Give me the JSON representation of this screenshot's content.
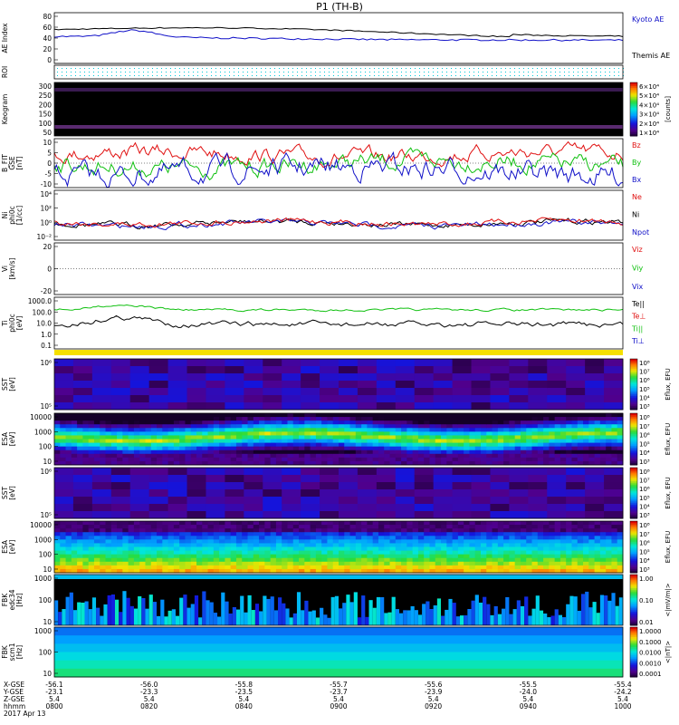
{
  "title": "P1 (TH-B)",
  "colors": {
    "black": "#000000",
    "blue": "#1010c8",
    "red": "#e01010",
    "green": "#10c010",
    "magenta": "#c000c0",
    "cyan": "#00c8d8"
  },
  "panels": [
    {
      "id": "ae",
      "ylabel": "AE Index",
      "ticks": [
        "80",
        "60",
        "40",
        "20",
        "0"
      ],
      "legend": [
        "Kyoto AE",
        "Themis AE"
      ]
    },
    {
      "id": "roi",
      "ylabel": "ROI",
      "ticks": []
    },
    {
      "id": "kp",
      "ylabel": "Keogram",
      "ticks": [
        "300",
        "250",
        "200",
        "150",
        "100",
        "50"
      ],
      "cbar": {
        "ticks": [
          "6×10⁴",
          "5×10⁴",
          "4×10⁴",
          "3×10⁴",
          "2×10⁴",
          "1×10⁴"
        ],
        "label": "[counts]"
      }
    },
    {
      "id": "bfit",
      "ylabel": "B_FIT\nGSE\n[nT]",
      "ticks": [
        "10",
        "5",
        "0",
        "-5",
        "-10"
      ],
      "legend": [
        "Bz",
        "By",
        "Bx"
      ]
    },
    {
      "id": "ni",
      "ylabel": "Ni\nphi0c\n[1/cc]",
      "ticks": [
        "10⁴",
        "10²",
        "10⁰",
        "10⁻²"
      ],
      "legend": [
        "Ne",
        "Ni",
        "Npot"
      ]
    },
    {
      "id": "vi",
      "ylabel": "Vi\n[km/s]",
      "ticks": [
        "20",
        "0",
        "-20"
      ],
      "legend": [
        "Viz",
        "Viy",
        "Vix"
      ]
    },
    {
      "id": "ti",
      "ylabel": "Ti\nphi0c\n[eV]",
      "ticks": [
        "1000.0",
        "100.0",
        "10.0",
        "1.0",
        "0.1"
      ],
      "legend": [
        "Te||",
        "Te⊥",
        "Ti||",
        "Ti⊥"
      ]
    },
    {
      "id": "sst1",
      "ylabel": "SST\n[eV]",
      "ticks": [
        "10⁶",
        "10⁵"
      ],
      "cbar": {
        "ticks": [
          "10⁸",
          "10⁷",
          "10⁶",
          "10⁵",
          "10⁴",
          "10³"
        ],
        "label": "Eflux, EFU"
      }
    },
    {
      "id": "esa1",
      "ylabel": "ESA\n[eV]",
      "ticks": [
        "10000",
        "1000",
        "100",
        "10"
      ],
      "cbar": {
        "ticks": [
          "10⁸",
          "10⁷",
          "10⁶",
          "10⁵",
          "10⁴",
          "10³"
        ],
        "label": "Eflux, EFU"
      }
    },
    {
      "id": "sst2",
      "ylabel": "SST\n[eV]",
      "ticks": [
        "10⁶",
        "10⁵"
      ],
      "cbar": {
        "ticks": [
          "10⁸",
          "10⁷",
          "10⁶",
          "10⁵",
          "10⁴",
          "10³"
        ],
        "label": "Eflux, EFU"
      }
    },
    {
      "id": "esa2",
      "ylabel": "ESA\n[eV]",
      "ticks": [
        "10000",
        "1000",
        "100",
        "10"
      ],
      "cbar": {
        "ticks": [
          "10⁸",
          "10⁷",
          "10⁶",
          "10⁵",
          "10⁴",
          "10³"
        ],
        "label": "Eflux, EFU"
      }
    },
    {
      "id": "fbk1",
      "ylabel": "FBK\nedc34\n[Hz]",
      "ticks": [
        "1000",
        "100",
        "10"
      ],
      "cbar": {
        "ticks": [
          "1.00",
          "0.10",
          "0.01"
        ],
        "label": "<|mV/m|>"
      }
    },
    {
      "id": "fbk2",
      "ylabel": "FBK\nscm1\n[Hz]",
      "ticks": [
        "1000",
        "100",
        "10"
      ],
      "cbar": {
        "ticks": [
          "1.0000",
          "0.1000",
          "0.0100",
          "0.0010",
          "0.0001"
        ],
        "label": "<|nT|>"
      }
    }
  ],
  "xaxis": {
    "row_labels": [
      "X-GSE",
      "Y-GSE",
      "Z-GSE",
      "hhmm",
      "2017 Apr 13"
    ],
    "columns": [
      [
        "-56.1",
        "-23.1",
        "5.4",
        "0800"
      ],
      [
        "-56.0",
        "-23.3",
        "5.4",
        "0820"
      ],
      [
        "-55.8",
        "-23.5",
        "5.4",
        "0840"
      ],
      [
        "-55.7",
        "-23.7",
        "5.4",
        "0900"
      ],
      [
        "-55.6",
        "-23.9",
        "5.4",
        "0920"
      ],
      [
        "-55.5",
        "-24.0",
        "5.4",
        "0940"
      ],
      [
        "-55.4",
        "-24.2",
        "5.4",
        "1000"
      ]
    ]
  },
  "chart_data": {
    "type": "line",
    "title": "P1 (TH-B)",
    "x": [
      "0800",
      "0820",
      "0840",
      "0900",
      "0920",
      "0940",
      "1000"
    ],
    "series": [
      {
        "name": "Kyoto AE",
        "values": [
          55,
          45,
          38,
          38,
          37,
          40,
          45
        ]
      },
      {
        "name": "Themis AE",
        "values": [
          62,
          68,
          58,
          52,
          48,
          50,
          53
        ]
      }
    ]
  }
}
